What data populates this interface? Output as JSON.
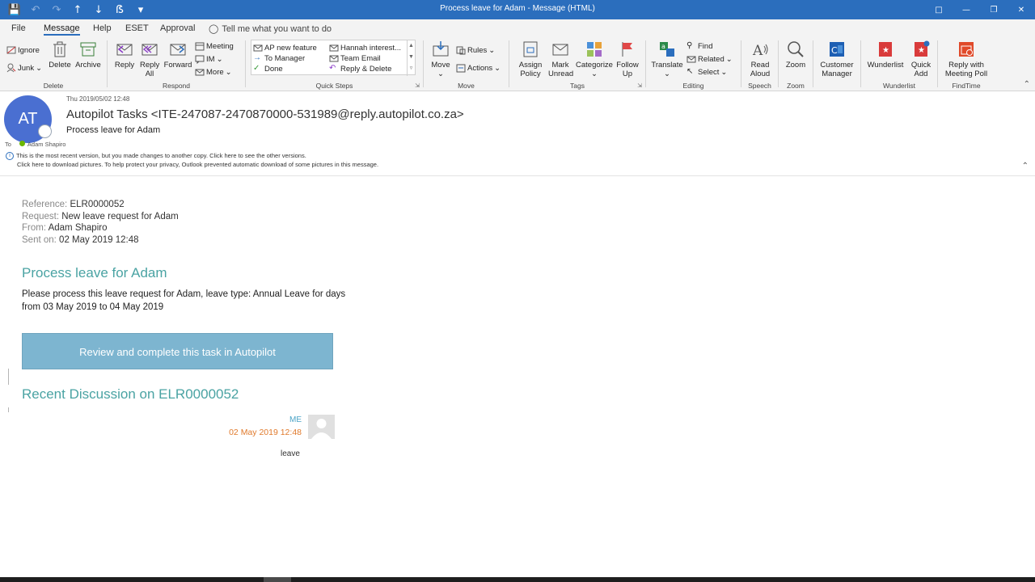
{
  "window": {
    "title": "Process leave for Adam  -  Message (HTML)"
  },
  "menu": {
    "tabs": [
      "File",
      "Message",
      "Help",
      "ESET",
      "Approval"
    ],
    "active": "Message",
    "tell_me": "Tell me what you want to do"
  },
  "ribbon": {
    "delete": {
      "ignore": "Ignore",
      "junk": "Junk",
      "delete": "Delete",
      "archive": "Archive",
      "label": "Delete"
    },
    "respond": {
      "reply": "Reply",
      "reply_all": "Reply All",
      "forward": "Forward",
      "meeting": "Meeting",
      "im": "IM",
      "more": "More",
      "label": "Respond"
    },
    "quick_steps": {
      "items": [
        "AP new feature",
        "To Manager",
        "Done",
        "Hannah interest...",
        "Team Email",
        "Reply & Delete"
      ],
      "label": "Quick Steps"
    },
    "move": {
      "move": "Move",
      "rules": "Rules",
      "actions": "Actions",
      "label": "Move"
    },
    "tags": {
      "assign_policy": "Assign Policy",
      "mark_unread": "Mark Unread",
      "categorize": "Categorize",
      "follow_up": "Follow Up",
      "label": "Tags"
    },
    "editing": {
      "translate": "Translate",
      "find": "Find",
      "related": "Related",
      "select": "Select",
      "label": "Editing"
    },
    "speech": {
      "read_aloud": "Read Aloud",
      "label": "Speech"
    },
    "zoom": {
      "zoom": "Zoom",
      "label": "Zoom"
    },
    "customer_manager": {
      "label_btn": "Customer Manager"
    },
    "wunderlist": {
      "wunderlist": "Wunderlist",
      "quick_add": "Quick Add",
      "label": "Wunderlist"
    },
    "findtime": {
      "reply_poll": "Reply with Meeting Poll",
      "label": "FindTime"
    }
  },
  "message": {
    "avatar_initials": "AT",
    "date": "Thu 2019/05/02 12:48",
    "from": "Autopilot Tasks <ITE-247087-2470870000-531989@reply.autopilot.co.za>",
    "subject": "Process leave for Adam",
    "to_label": "To",
    "to_name": "Adam Shapiro",
    "info_line1": "This is the most recent version, but you made changes to another copy. Click here to see the other versions.",
    "info_line2": "Click here to download pictures. To help protect your privacy, Outlook prevented automatic download of some pictures in this message."
  },
  "body": {
    "reference_label": "Reference:",
    "reference_value": "ELR0000052",
    "request_label": "Request:",
    "request_value": "New leave request for Adam",
    "from_label": "From:",
    "from_value": "Adam Shapiro",
    "sent_label": "Sent on:",
    "sent_value": "02 May 2019 12:48",
    "heading": "Process leave for Adam",
    "description": "Please process this leave request for Adam, leave type: Annual Leave for days from 03 May 2019 to 04 May 2019",
    "cta": "Review and complete this task in Autopilot",
    "recent_heading": "Recent Discussion on ELR0000052",
    "discussion": {
      "author": "ME",
      "time": "02 May 2019 12:48",
      "text": "leave"
    }
  }
}
